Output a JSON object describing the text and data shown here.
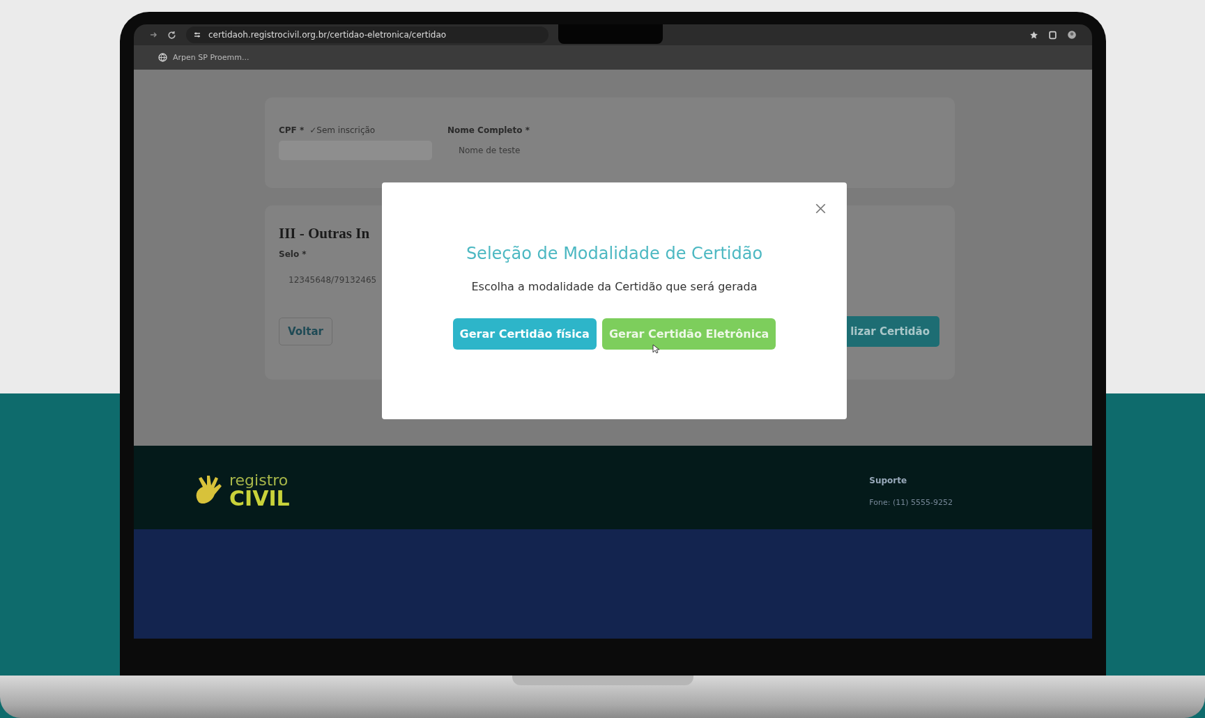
{
  "browser": {
    "url": "certidaoh.registrocivil.org.br/certidao-eletronica/certidao",
    "bookmark": "Arpen SP Proemm..."
  },
  "form": {
    "cpf_label": "CPF *",
    "cpf_note": "✓Sem inscrição",
    "name_label": "Nome Completo *",
    "name_value": "Nome de teste",
    "section_title": "III - Outras In",
    "selo_label": "Selo *",
    "selo_value": "12345648/79132465",
    "back_button": "Voltar",
    "finish_button": "lizar Certidão"
  },
  "modal": {
    "title": "Seleção de Modalidade de Certidão",
    "message": "Escolha a modalidade da Certidão que será gerada",
    "buttons": [
      {
        "label": "Gerar Certidão física",
        "kind": "physical"
      },
      {
        "label": "Gerar Certidão Eletrônica",
        "kind": "electronic"
      }
    ]
  },
  "footer": {
    "logo_top": "registro",
    "logo_bottom": "CIVIL",
    "support_title": "Suporte",
    "phone": "Fone: (11) 5555-9252"
  }
}
